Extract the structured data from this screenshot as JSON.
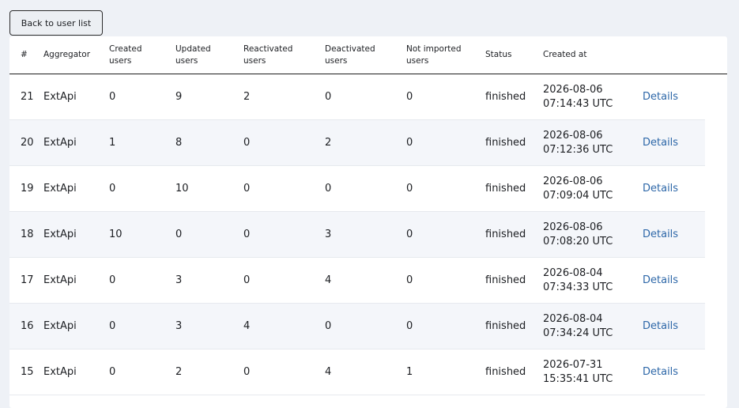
{
  "back_button": {
    "label": "Back to user list"
  },
  "columns": [
    {
      "line1": "#",
      "line2": ""
    },
    {
      "line1": "Aggregator",
      "line2": ""
    },
    {
      "line1": "Created",
      "line2": "users"
    },
    {
      "line1": "Updated",
      "line2": "users"
    },
    {
      "line1": "Reactivated",
      "line2": "users"
    },
    {
      "line1": "Deactivated",
      "line2": "users"
    },
    {
      "line1": "Not imported",
      "line2": "users"
    },
    {
      "line1": "Status",
      "line2": ""
    },
    {
      "line1": "Created at",
      "line2": ""
    },
    {
      "line1": "",
      "line2": ""
    }
  ],
  "rows": [
    {
      "id": "21",
      "aggregator": "ExtApi",
      "created": "0",
      "updated": "9",
      "reactivated": "2",
      "deactivated": "0",
      "not_imported": "0",
      "status": "finished",
      "date": "2026-08-06",
      "time": "07:14:43 UTC",
      "action": "Details"
    },
    {
      "id": "20",
      "aggregator": "ExtApi",
      "created": "1",
      "updated": "8",
      "reactivated": "0",
      "deactivated": "2",
      "not_imported": "0",
      "status": "finished",
      "date": "2026-08-06",
      "time": "07:12:36 UTC",
      "action": "Details"
    },
    {
      "id": "19",
      "aggregator": "ExtApi",
      "created": "0",
      "updated": "10",
      "reactivated": "0",
      "deactivated": "0",
      "not_imported": "0",
      "status": "finished",
      "date": "2026-08-06",
      "time": "07:09:04 UTC",
      "action": "Details"
    },
    {
      "id": "18",
      "aggregator": "ExtApi",
      "created": "10",
      "updated": "0",
      "reactivated": "0",
      "deactivated": "3",
      "not_imported": "0",
      "status": "finished",
      "date": "2026-08-06",
      "time": "07:08:20 UTC",
      "action": "Details"
    },
    {
      "id": "17",
      "aggregator": "ExtApi",
      "created": "0",
      "updated": "3",
      "reactivated": "0",
      "deactivated": "4",
      "not_imported": "0",
      "status": "finished",
      "date": "2026-08-04",
      "time": "07:34:33 UTC",
      "action": "Details"
    },
    {
      "id": "16",
      "aggregator": "ExtApi",
      "created": "0",
      "updated": "3",
      "reactivated": "4",
      "deactivated": "0",
      "not_imported": "0",
      "status": "finished",
      "date": "2026-08-04",
      "time": "07:34:24 UTC",
      "action": "Details"
    },
    {
      "id": "15",
      "aggregator": "ExtApi",
      "created": "0",
      "updated": "2",
      "reactivated": "0",
      "deactivated": "4",
      "not_imported": "1",
      "status": "finished",
      "date": "2026-07-31",
      "time": "15:35:41 UTC",
      "action": "Details"
    }
  ],
  "colors": {
    "background": "#eef1f6",
    "link": "#2d67a8",
    "stripe": "#f4f6fa"
  }
}
